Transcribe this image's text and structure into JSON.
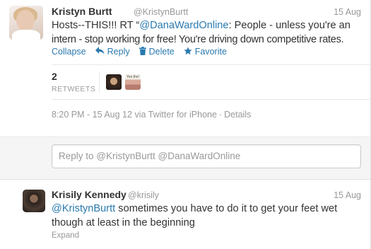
{
  "main_tweet": {
    "author_name": "Kristyn Burtt",
    "author_handle": "@KristynBurtt",
    "date": "15 Aug",
    "text_line1_prefix": "Hosts--THIS!!! RT “",
    "text_line1_mention": "@DanaWardOnline",
    "text_line1_suffix": ": People - unless you're an",
    "text_line2": "intern - stop working for free! You're driving down competitive rates.",
    "actions": {
      "collapse": "Collapse",
      "reply": "Reply",
      "delete": "Delete",
      "favorite": "Favorite"
    },
    "retweets": {
      "count": "2",
      "label": "RETWEETS"
    },
    "meta": {
      "timestamp": "8:20 PM - 15 Aug 12",
      "via": "via Twitter for iPhone",
      "separator": "·",
      "details": "Details"
    },
    "retweeter_avatar_caption": "Yes the!"
  },
  "reply_box": {
    "placeholder": "Reply to @KristynBurtt @DanaWardOnline"
  },
  "reply_tweet": {
    "author_name": "Krisily Kennedy",
    "author_handle": "@krisily",
    "date": "15 Aug",
    "text_mention": "@KristynBurtt",
    "text_line1_suffix": " sometimes you have to do it to get your feet wet",
    "text_line2": "though at least in the beginning",
    "expand": "Expand"
  },
  "icons": {
    "reply": "reply-arrow-icon",
    "delete": "trash-icon",
    "favorite": "star-icon"
  },
  "colors": {
    "link": "#2a7ab0",
    "muted": "#999999",
    "text": "#333333"
  }
}
